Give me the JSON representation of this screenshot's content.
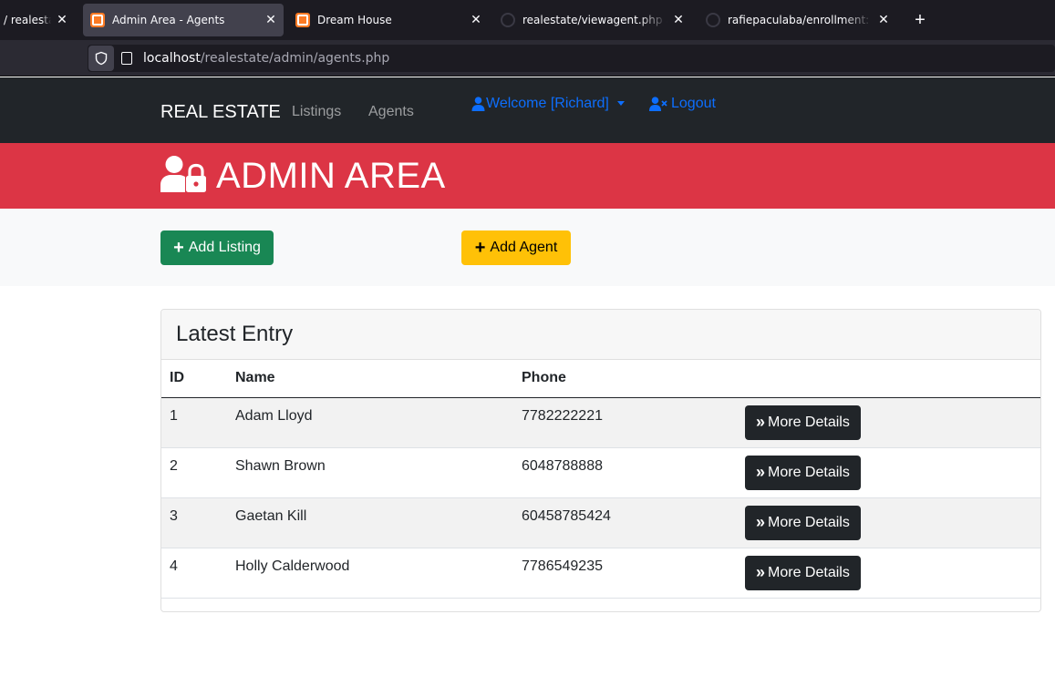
{
  "browser": {
    "tabs": [
      {
        "title": "/ realestate",
        "favicon": "github-icon",
        "active": false
      },
      {
        "title": "Admin Area - Agents",
        "favicon": "xampp-icon",
        "active": true
      },
      {
        "title": "Dream House",
        "favicon": "xampp-icon",
        "active": false
      },
      {
        "title": "realestate/viewagent.php at main",
        "favicon": "github-icon",
        "active": false
      },
      {
        "title": "rafiepaculaba/enrollment: a private",
        "favicon": "github-icon",
        "active": false
      }
    ],
    "close_glyph": "✕",
    "new_tab_glyph": "+",
    "url": {
      "host": "localhost",
      "path": "/realestate/admin/agents.php"
    }
  },
  "navbar": {
    "brand": "REAL ESTATE",
    "links": [
      "Listings",
      "Agents"
    ],
    "welcome": "Welcome [Richard]",
    "logout": "Logout"
  },
  "banner": {
    "title": "ADMIN AREA"
  },
  "actions": {
    "add_listing": "Add Listing",
    "add_agent": "Add Agent"
  },
  "card": {
    "header": "Latest Entry",
    "columns": [
      "ID",
      "Name",
      "Phone"
    ],
    "rows": [
      {
        "id": "1",
        "name": "Adam Lloyd",
        "phone": "7782222221"
      },
      {
        "id": "2",
        "name": "Shawn Brown",
        "phone": "6048788888"
      },
      {
        "id": "3",
        "name": "Gaetan Kill",
        "phone": "60458785424"
      },
      {
        "id": "4",
        "name": "Holly Calderwood",
        "phone": "7786549235"
      }
    ],
    "row_button": "More Details"
  },
  "colors": {
    "navbar_bg": "#212529",
    "banner_bg": "#dc3545",
    "success": "#198754",
    "warning": "#ffc107",
    "link_blue": "#0d6efd"
  }
}
